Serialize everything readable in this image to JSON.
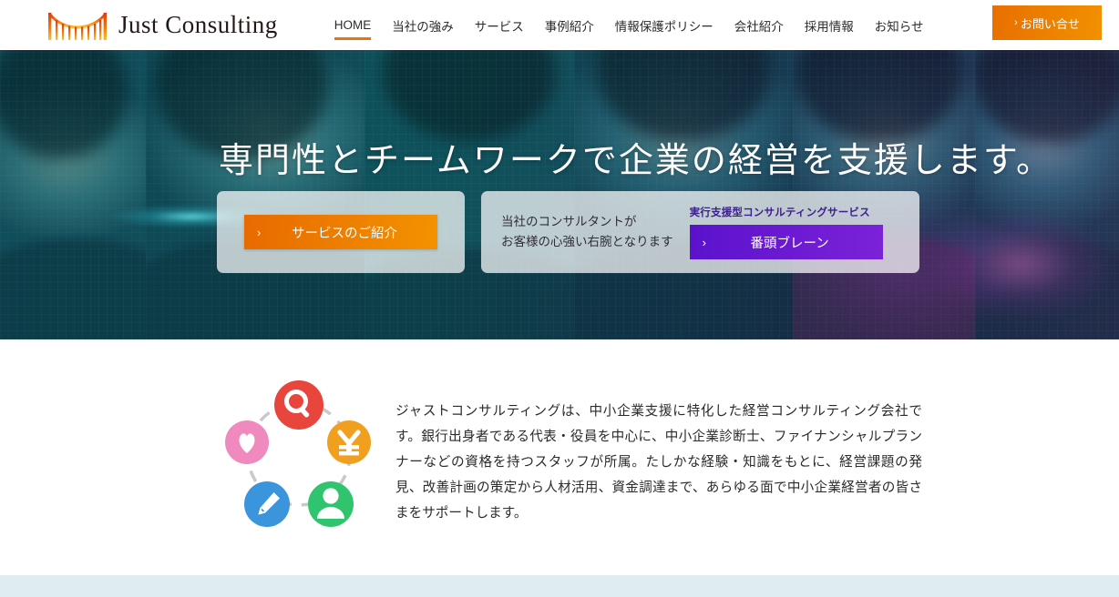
{
  "site": {
    "logo_text": "Just Consulting",
    "logo_icon": "bridge-icon"
  },
  "nav": {
    "items": [
      {
        "label": "HOME",
        "active": true
      },
      {
        "label": "当社の強み",
        "active": false
      },
      {
        "label": "サービス",
        "active": false
      },
      {
        "label": "事例紹介",
        "active": false
      },
      {
        "label": "情報保護ポリシー",
        "active": false
      },
      {
        "label": "会社紹介",
        "active": false
      },
      {
        "label": "採用情報",
        "active": false
      },
      {
        "label": "お知らせ",
        "active": false
      }
    ],
    "contact_button": "お問い合せ",
    "chevron": "›"
  },
  "hero": {
    "title": "専門性とチームワークで企業の経営を支援します。",
    "card_service": {
      "button_label": "サービスのご紹介",
      "chevron": "›"
    },
    "card_banto": {
      "text_line1": "当社のコンサルタントが",
      "text_line2": "お客様の心強い右腕となります",
      "label": "実行支援型コンサルティングサービス",
      "button_label": "番頭ブレーン",
      "chevron": "›"
    }
  },
  "intro": {
    "paragraph": "ジャストコンサルティングは、中小企業支援に特化した経営コンサルティング会社です。銀行出身者である代表・役員を中心に、中小企業診断士、ファイナンシャルプランナーなどの資格を持つスタッフが所属。たしかな経験・知識をもとに、経営課題の発見、改善計画の策定から人材活用、資金調達まで、あらゆる面で中小企業経営者の皆さまをサポートします。",
    "icons": [
      {
        "name": "search-icon",
        "color": "#e8453c"
      },
      {
        "name": "yen-icon",
        "color": "#f0a01e"
      },
      {
        "name": "person-icon",
        "color": "#31c46e"
      },
      {
        "name": "pencil-icon",
        "color": "#3b95dc"
      },
      {
        "name": "heart-icon",
        "color": "#f089bd"
      }
    ]
  },
  "colors": {
    "accent_orange": "#e8740c",
    "accent_purple": "#5b12cc",
    "band_blue": "#dfedf3"
  }
}
